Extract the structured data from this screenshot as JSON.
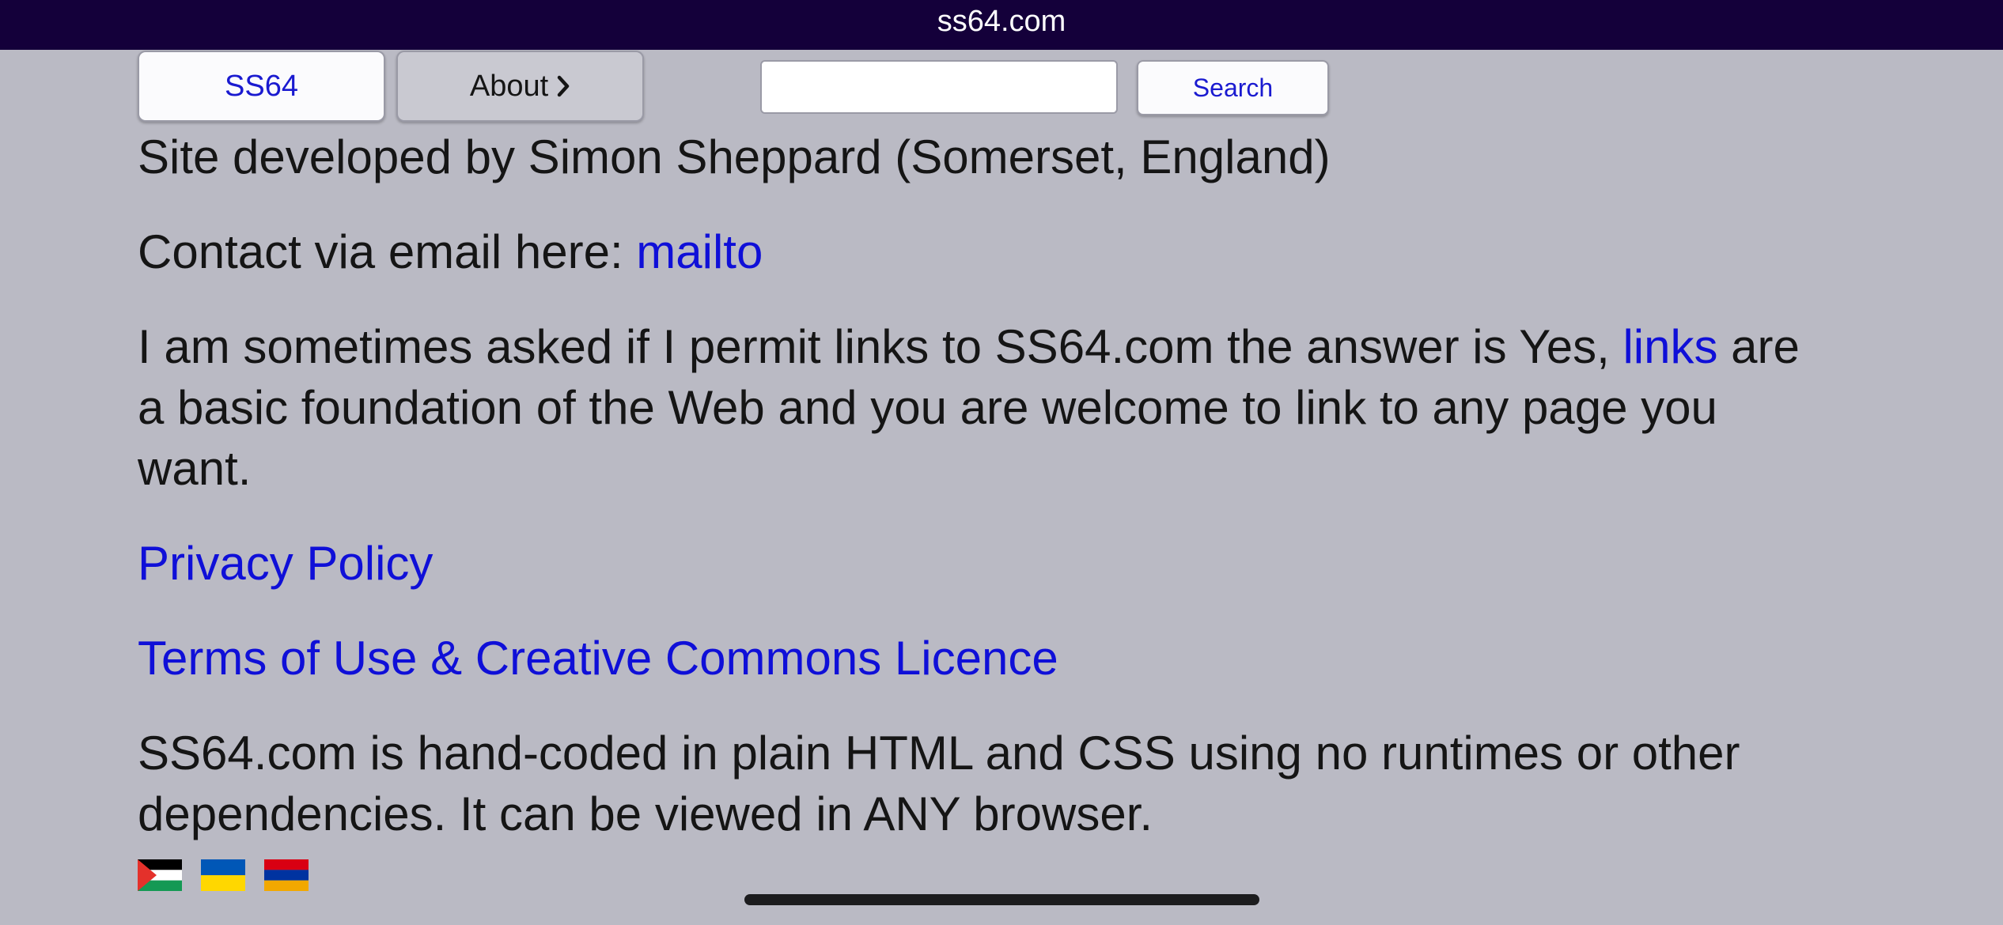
{
  "browser": {
    "url": "ss64.com"
  },
  "nav": {
    "home_label": "SS64",
    "about_label": "About",
    "search_placeholder": "",
    "search_label": "Search"
  },
  "content": {
    "developer_line": "Site developed by Simon Sheppard (Somerset, England)",
    "contact_prefix": "Contact via email here: ",
    "contact_link": "mailto",
    "links_text_before": "I am sometimes asked if I permit links to SS64.com the answer is Yes, ",
    "links_link": "links",
    "links_text_after": " are a basic foundation of the Web and you are welcome to link to any page you want.",
    "privacy_link": "Privacy Policy",
    "terms_link": "Terms of Use & Creative Commons Licence",
    "handcoded_text": "SS64.com is hand-coded in plain HTML and CSS using no runtimes or other dependencies. It can be viewed in ANY browser."
  },
  "flags": [
    {
      "name": "palestine",
      "colors": [
        "#000000",
        "#ffffff",
        "#149954",
        "#e4312b"
      ]
    },
    {
      "name": "ukraine",
      "colors": [
        "#0057b7",
        "#ffd700"
      ]
    },
    {
      "name": "armenia",
      "colors": [
        "#d90012",
        "#0033a0",
        "#f2a800"
      ]
    }
  ],
  "colors": {
    "background": "#babac4",
    "url_bar": "#14003a",
    "link": "#0f0fd8",
    "text": "#151515"
  }
}
